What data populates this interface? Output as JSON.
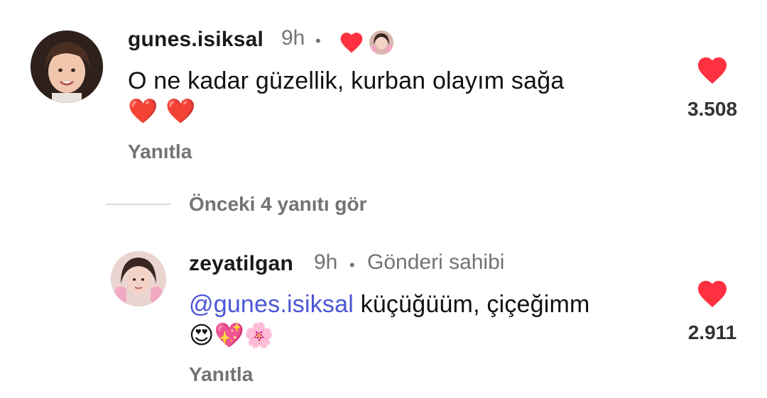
{
  "comments": [
    {
      "username": "gunes.isiksal",
      "time": "9h",
      "separator": "•",
      "text": "O ne kadar güzellik, kurban olayım sağa",
      "emojis": "❤️ ❤️",
      "reply_label": "Yanıtla",
      "likes": "3.508"
    },
    {
      "username": "zeyatilgan",
      "time": "9h",
      "separator": "•",
      "author_badge": "Gönderi sahibi",
      "mention": "@gunes.isiksal",
      "text": " küçüğüüm, çiçeğimm",
      "emojis": "😍💖🌸",
      "reply_label": "Yanıtla",
      "likes": "2.911"
    }
  ],
  "view_replies": "Önceki 4 yanıtı gör",
  "colors": {
    "heart": "#ff3040",
    "mention": "#4a56d6",
    "meta": "#737373"
  }
}
